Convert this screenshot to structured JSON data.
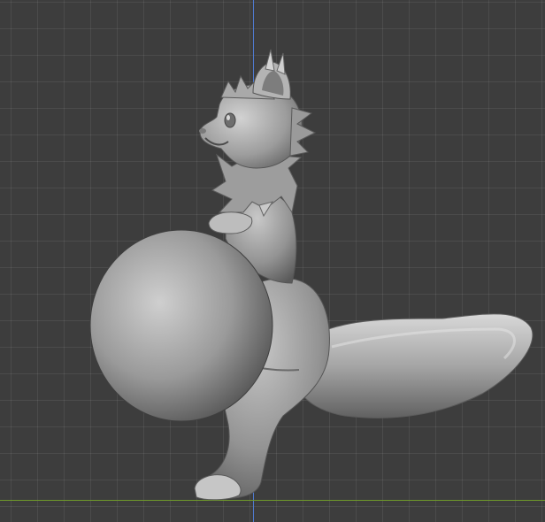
{
  "viewport": {
    "background": "#3d3d3d",
    "grid_color": "#4a4a4a",
    "axis_vertical_color": "#4f7bd1",
    "axis_horizontal_color": "#6f9a2a"
  },
  "model": {
    "kind": "sculpted creature mesh",
    "material_color": "#a8a8a8"
  }
}
